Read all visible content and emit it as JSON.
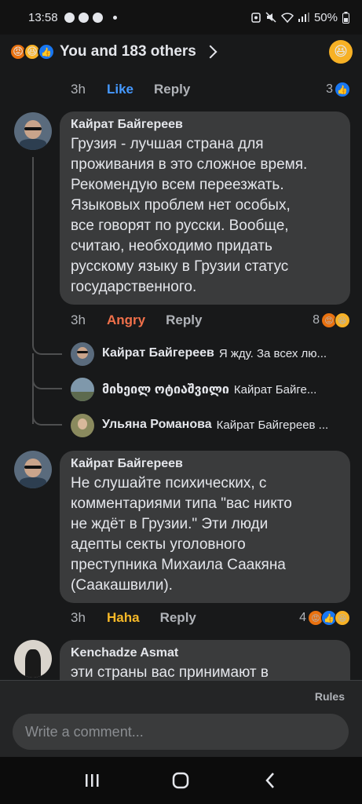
{
  "status_bar": {
    "time": "13:58",
    "battery": "50%"
  },
  "header": {
    "title": "You and 183 others",
    "reactions": [
      "angry",
      "haha",
      "like"
    ]
  },
  "top_action": {
    "time": "3h",
    "reaction": "Like",
    "reaction_color": "#4599ff",
    "reply": "Reply",
    "count": "3"
  },
  "comments": [
    {
      "author": "Кайрат Байгереев",
      "text": "Грузия - лучшая страна для\nпроживания в это сложное время.\nРекомендую всем переезжать.\nЯзыковых проблем нет особых,\nвсе говорят по русски. Вообще,\nсчитаю, необходимо придать\nрусскому языку в Грузии статус\nгосударственного.",
      "time": "3h",
      "reaction": "Angry",
      "reaction_color": "#f0704a",
      "reply": "Reply",
      "count": "8"
    },
    {
      "author": "Кайрат Байгереев",
      "text": "Не слушайте психических, с\nкомментариями типа \"вас никто\nне ждёт в Грузии.\" Эти люди\nадепты секты уголовного\nпреступника Михаила Саакяна\n(Саакашвили).",
      "time": "3h",
      "reaction": "Haha",
      "reaction_color": "#f7b928",
      "reply": "Reply",
      "count": "4"
    },
    {
      "author": "Kenchadze Asmat",
      "text": "эти страны вас принимают в"
    }
  ],
  "replies": [
    {
      "author": "Кайрат Байгереев",
      "text": "Я жду. За всех лю..."
    },
    {
      "author": "მიხეილ ოტიაშვილი",
      "text": "Кайрат Байге..."
    },
    {
      "author": "Ульяна Романова",
      "text": "Кайрат Байгереев ..."
    }
  ],
  "footer": {
    "rules": "Rules",
    "comment_placeholder": "Write a comment..."
  }
}
